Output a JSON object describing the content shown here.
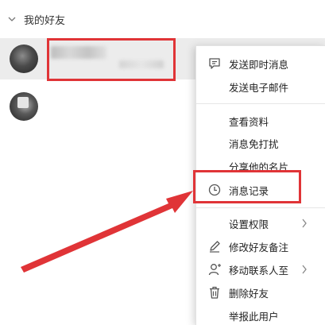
{
  "friend_group": {
    "label": "我的好友"
  },
  "context_menu": {
    "items": [
      {
        "label": "发送即时消息",
        "icon": "chat-bubble-icon"
      },
      {
        "label": "发送电子邮件",
        "icon": ""
      },
      {
        "label": "查看资料",
        "icon": ""
      },
      {
        "label": "消息免打扰",
        "icon": ""
      },
      {
        "label": "分享他的名片",
        "icon": ""
      },
      {
        "label": "消息记录",
        "icon": "clock-icon"
      },
      {
        "label": "设置权限",
        "icon": "",
        "submenu": true
      },
      {
        "label": "修改好友备注",
        "icon": "pencil-icon"
      },
      {
        "label": "移动联系人至",
        "icon": "person-add-icon",
        "submenu": true
      },
      {
        "label": "删除好友",
        "icon": "trash-icon"
      },
      {
        "label": "举报此用户",
        "icon": ""
      }
    ]
  },
  "colors": {
    "highlight_border": "#e03437",
    "selected_row": "#ececec",
    "annotation_arrow": "#e03437"
  }
}
